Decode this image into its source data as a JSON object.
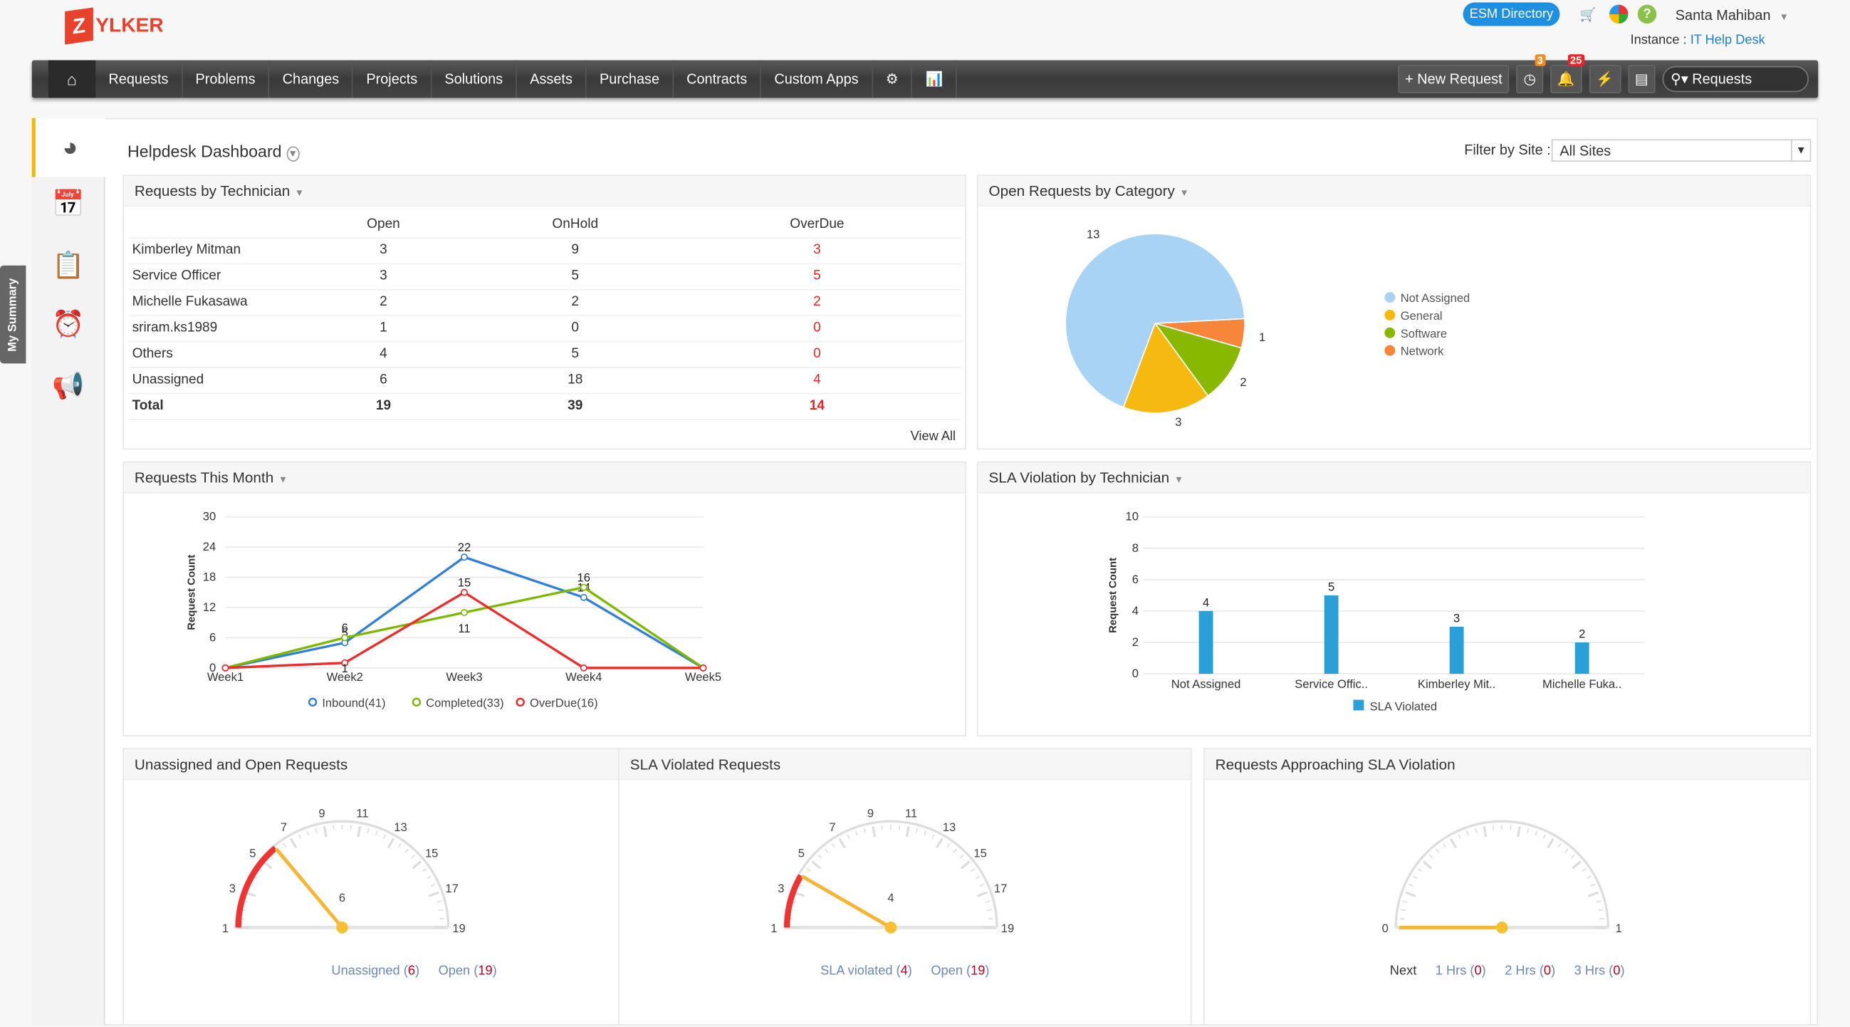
{
  "header": {
    "logo_letter": "Z",
    "logo_rest": "YLKER",
    "esm_label": "ESM Directory",
    "user": "Santa Mahiban",
    "instance_label": "Instance :",
    "instance_value": "IT Help Desk"
  },
  "nav": {
    "items": [
      "Requests",
      "Problems",
      "Changes",
      "Projects",
      "Solutions",
      "Assets",
      "Purchase",
      "Contracts",
      "Custom Apps"
    ],
    "new_request": "+ New Request",
    "badge_timer": "3",
    "badge_bell": "25",
    "search_label": "Requests"
  },
  "sidebar": {
    "my_summary": "My Summary"
  },
  "dashboard": {
    "title": "Helpdesk Dashboard",
    "filter_label": "Filter by Site :",
    "filter_value": "All Sites"
  },
  "tech": {
    "title": "Requests by Technician",
    "columns": [
      "",
      "Open",
      "OnHold",
      "OverDue"
    ],
    "rows": [
      [
        "Kimberley Mitman",
        "3",
        "9",
        "3"
      ],
      [
        "Service Officer",
        "3",
        "5",
        "5"
      ],
      [
        "Michelle Fukasawa",
        "2",
        "2",
        "2"
      ],
      [
        "sriram.ks1989",
        "1",
        "0",
        "0"
      ],
      [
        "Others",
        "4",
        "5",
        "0"
      ],
      [
        "Unassigned",
        "6",
        "18",
        "4"
      ],
      [
        "Total",
        "19",
        "39",
        "14"
      ]
    ],
    "view_all": "View All"
  },
  "chart_data": [
    {
      "type": "pie",
      "title": "Open Requests by Category",
      "categories": [
        "Not Assigned",
        "General",
        "Software",
        "Network"
      ],
      "values": [
        13,
        3,
        2,
        1
      ],
      "colors": [
        "#a9d3f5",
        "#f5b90f",
        "#88b800",
        "#f7853a"
      ],
      "legend": "right"
    },
    {
      "type": "line",
      "title": "Requests This Month",
      "ylabel": "Request Count",
      "categories": [
        "Week1",
        "Week2",
        "Week3",
        "Week4",
        "Week5"
      ],
      "ylim": [
        0,
        30
      ],
      "yticks": [
        0,
        6,
        12,
        18,
        24,
        30
      ],
      "grid": true,
      "legend": "bottom",
      "series": [
        {
          "name": "Inbound(41)",
          "color": "#2f7fd8",
          "values": [
            0,
            5,
            22,
            14,
            0
          ]
        },
        {
          "name": "Completed(33)",
          "color": "#7fb800",
          "values": [
            0,
            6,
            11,
            16,
            0
          ]
        },
        {
          "name": "OverDue(16)",
          "color": "#ee2a2a",
          "values": [
            0,
            1,
            15,
            0,
            0
          ]
        }
      ]
    },
    {
      "type": "bar",
      "title": "SLA Violation by Technician",
      "ylabel": "Request Count",
      "categories": [
        "Not Assigned",
        "Service Offic..",
        "Kimberley Mit..",
        "Michelle Fuka.."
      ],
      "values": [
        4,
        5,
        3,
        2
      ],
      "ylim": [
        0,
        10
      ],
      "yticks": [
        0,
        2,
        4,
        6,
        8,
        10
      ],
      "color": "#2a9fd8",
      "series_name": "SLA Violated",
      "legend": "bottom",
      "grid": true
    }
  ],
  "gauges": [
    {
      "title": "Unassigned and Open Requests",
      "value": 6,
      "min": 1,
      "max": 19,
      "ticks": [
        1,
        3,
        5,
        7,
        9,
        11,
        13,
        15,
        17,
        19
      ],
      "legend": [
        {
          "label": "Unassigned",
          "count": "6"
        },
        {
          "label": "Open",
          "count": "19"
        }
      ]
    },
    {
      "title": "SLA Violated Requests",
      "value": 4,
      "min": 1,
      "max": 19,
      "ticks": [
        1,
        3,
        5,
        7,
        9,
        11,
        13,
        15,
        17,
        19
      ],
      "legend": [
        {
          "label": "SLA violated",
          "count": "4"
        },
        {
          "label": "Open",
          "count": "19"
        }
      ]
    },
    {
      "title": "Requests Approaching SLA Violation",
      "value": 0,
      "min": 0,
      "max": 1,
      "ticks": [
        0,
        1
      ],
      "legend": [
        {
          "label": "Next",
          "count": ""
        },
        {
          "label": "1 Hrs",
          "count": "0"
        },
        {
          "label": "2 Hrs",
          "count": "0"
        },
        {
          "label": "3 Hrs",
          "count": "0"
        }
      ]
    }
  ]
}
